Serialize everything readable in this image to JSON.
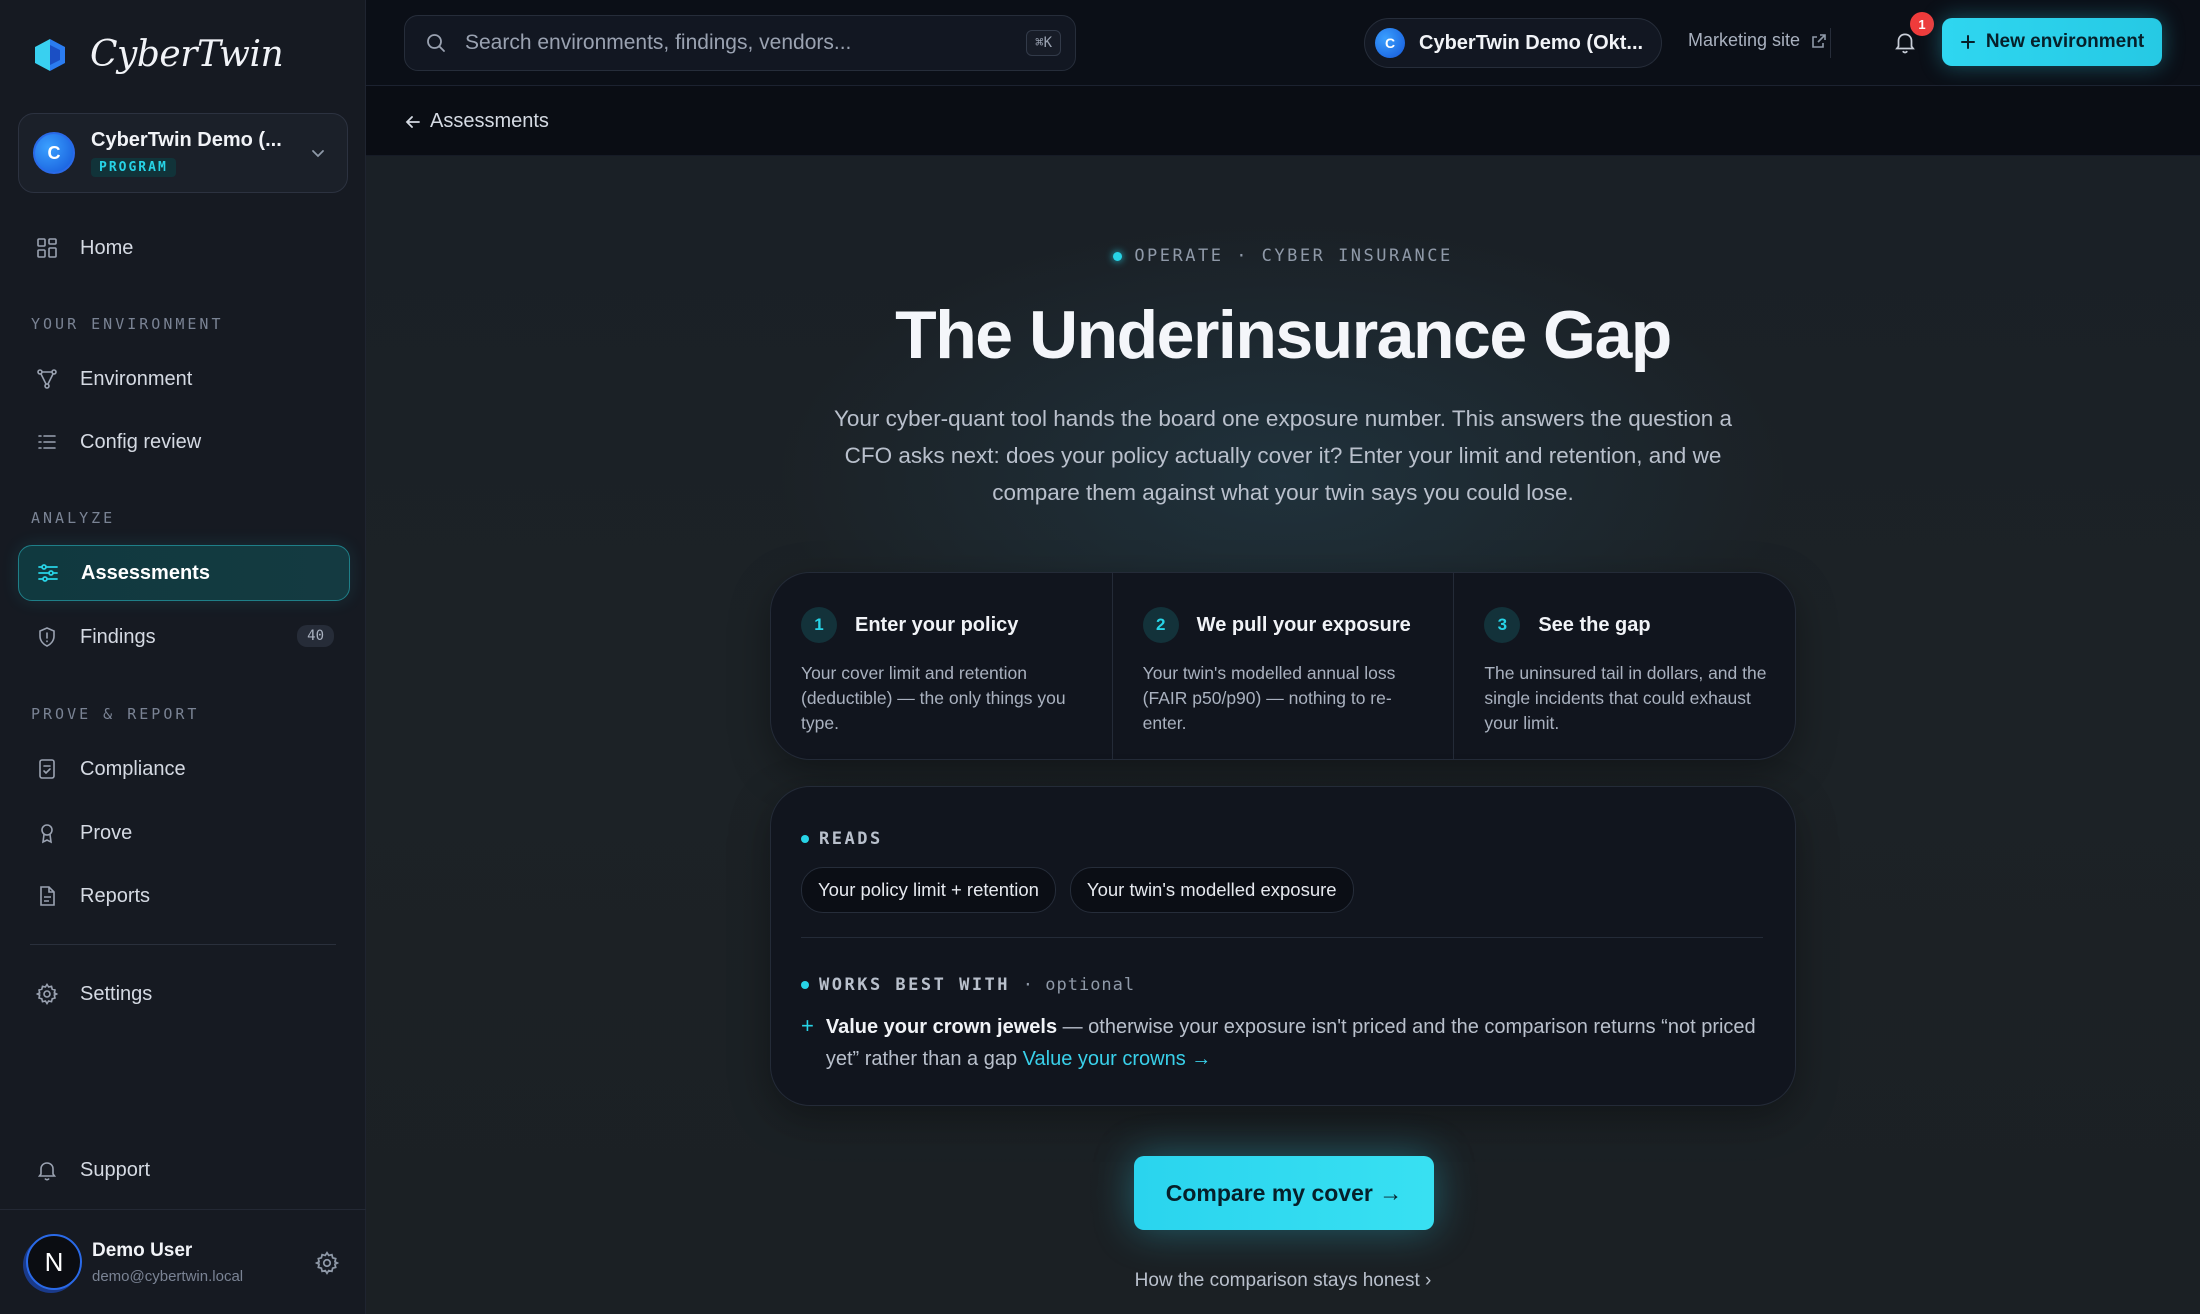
{
  "brand": {
    "name": "CyberTwin"
  },
  "workspace": {
    "avatar_letter": "C",
    "name": "CyberTwin Demo (...",
    "badge": "PROGRAM"
  },
  "sidebar": {
    "home": "Home",
    "section_env": "YOUR ENVIRONMENT",
    "environment": "Environment",
    "config_review": "Config review",
    "section_analyze": "ANALYZE",
    "assessments": "Assessments",
    "findings": "Findings",
    "findings_count": "40",
    "section_prove": "PROVE & REPORT",
    "compliance": "Compliance",
    "prove": "Prove",
    "reports": "Reports",
    "settings": "Settings",
    "support": "Support"
  },
  "user": {
    "avatar_letter": "N",
    "name": "Demo User",
    "email": "demo@cybertwin.local"
  },
  "topbar": {
    "search_placeholder": "Search environments, findings, vendors...",
    "search_shortcut": "⌘K",
    "env_letter": "C",
    "env_name": "CyberTwin Demo (Okt...",
    "marketing_link": "Marketing site",
    "notification_count": "1",
    "new_env_label": "New environment"
  },
  "breadcrumb": {
    "back_label": "Assessments"
  },
  "hero": {
    "eyebrow": "OPERATE · CYBER INSURANCE",
    "title": "The Underinsurance Gap",
    "lede": "Your cyber-quant tool hands the board one exposure number. This answers the question a CFO asks next: does your policy actually cover it? Enter your limit and retention, and we compare them against what your twin says you could lose."
  },
  "steps": [
    {
      "num": "1",
      "title": "Enter your policy",
      "body": "Your cover limit and retention (deductible) — the only things you type."
    },
    {
      "num": "2",
      "title": "We pull your exposure",
      "body": "Your twin's modelled annual loss (FAIR p50/p90) — nothing to re-enter."
    },
    {
      "num": "3",
      "title": "See the gap",
      "body": "The uninsured tail in dollars, and the single incidents that could exhaust your limit."
    }
  ],
  "reads": {
    "label": "READS",
    "chips": [
      "Your policy limit + retention",
      "Your twin's modelled exposure"
    ],
    "works_label": "WORKS BEST WITH",
    "works_optional": "· optional",
    "tip_strong": "Value your crown jewels",
    "tip_body": " — otherwise your exposure isn't priced and the comparison returns “not priced yet” rather than a gap ",
    "tip_link": "Value your crowns →"
  },
  "cta": {
    "label": "Compare my cover →",
    "footer_link": "How the comparison stays honest ›"
  }
}
